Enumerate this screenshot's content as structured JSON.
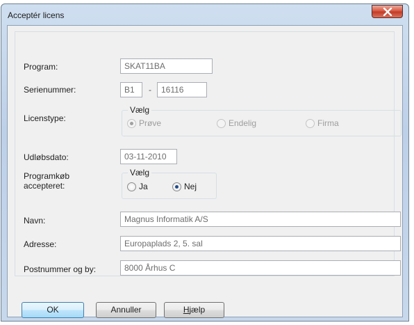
{
  "window": {
    "title": "Acceptér licens",
    "close_glyph": "✕"
  },
  "form": {
    "program": {
      "label": "Program:",
      "value": "SKAT11BA"
    },
    "serienummer": {
      "label": "Serienummer:",
      "part1": "B1",
      "separator": "-",
      "part2": "16116"
    },
    "licenstype": {
      "label": "Licenstype:",
      "group_title": "Vælg",
      "options": [
        {
          "label": "Prøve",
          "selected": true,
          "enabled": false
        },
        {
          "label": "Endelig",
          "selected": false,
          "enabled": false
        },
        {
          "label": "Firma",
          "selected": false,
          "enabled": false
        }
      ]
    },
    "udloebsdato": {
      "label": "Udløbsdato:",
      "value": "03-11-2010"
    },
    "programkoeb": {
      "label_line1": "Programkøb",
      "label_line2": "accepteret:",
      "group_title": "Vælg",
      "options": [
        {
          "label": "Ja",
          "selected": false,
          "enabled": true
        },
        {
          "label": "Nej",
          "selected": true,
          "enabled": true
        }
      ]
    },
    "navn": {
      "label": "Navn:",
      "value": "Magnus Informatik A/S"
    },
    "adresse": {
      "label": "Adresse:",
      "value": "Europaplads 2, 5. sal"
    },
    "postnummer": {
      "label": "Postnummer og by:",
      "value": "8000 Århus C"
    }
  },
  "buttons": {
    "ok": "OK",
    "cancel": "Annuller",
    "help_prefix": "H",
    "help_rest": "jælp"
  },
  "colors": {
    "title_gradient": "#c7d8ec",
    "close_red": "#c23a25",
    "dialog_bg": "#f0f0f0",
    "selected_radio": "#1f4a8a"
  }
}
